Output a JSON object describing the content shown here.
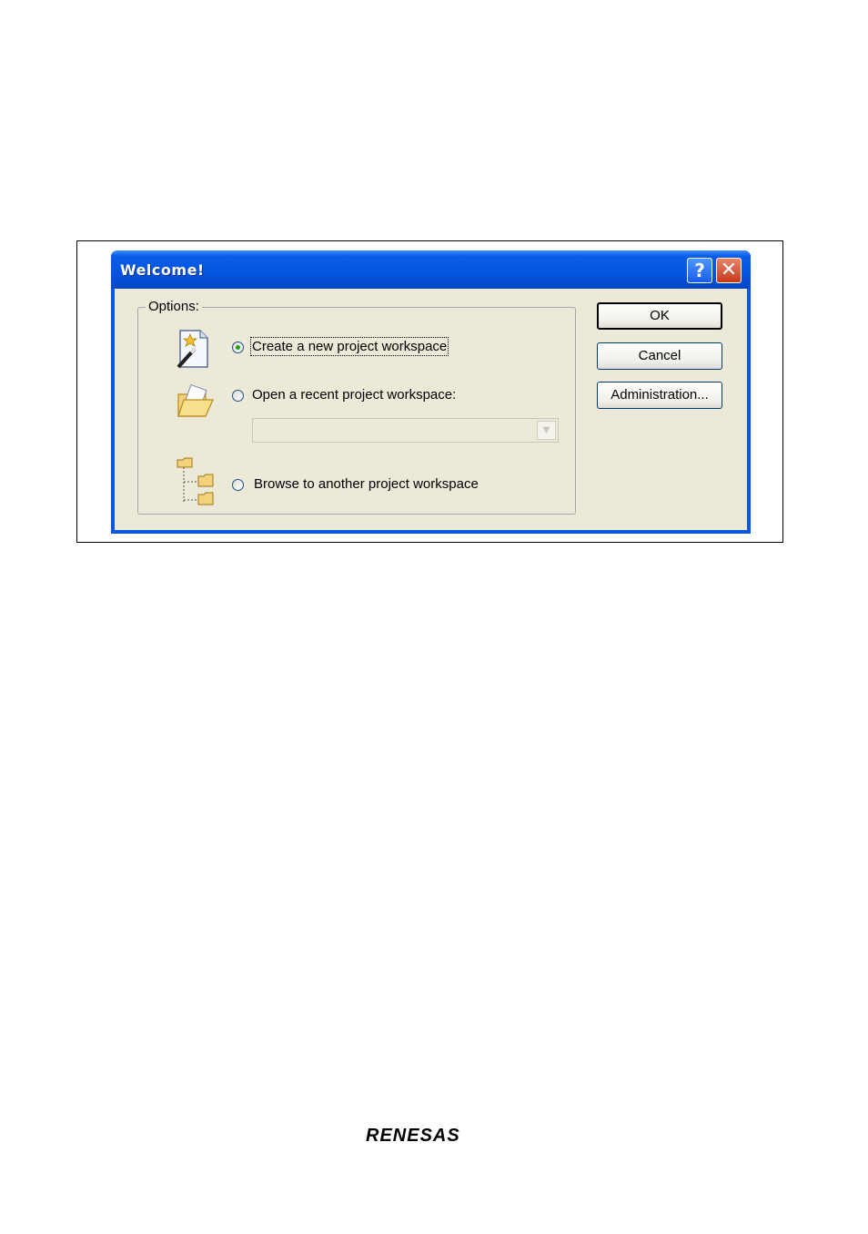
{
  "dialog": {
    "title": "Welcome!",
    "help_label": "?",
    "close_label": "✕",
    "group_label": "Options:",
    "options": [
      {
        "label": "Create a new project workspace",
        "selected": true
      },
      {
        "label": "Open a recent project workspace:",
        "selected": false
      },
      {
        "label": "Browse to another project workspace",
        "selected": false
      }
    ],
    "recent_combo": {
      "value": "",
      "disabled": true
    },
    "buttons": {
      "ok": "OK",
      "cancel": "Cancel",
      "administration": "Administration..."
    }
  },
  "footer": {
    "logo_text": "RENESAS"
  },
  "colors": {
    "titlebar": "#0a5de8",
    "client_bg": "#ece9d8",
    "radio_selected": "#21a121"
  }
}
